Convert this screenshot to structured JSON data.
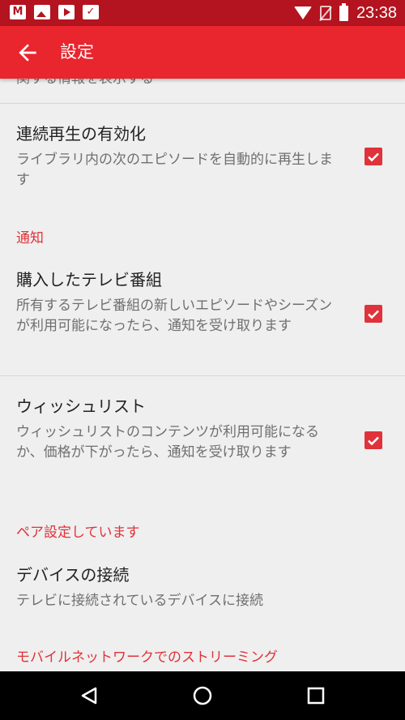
{
  "status_bar": {
    "time": "23:38",
    "left_icons": [
      "mail-icon",
      "photo-icon",
      "play-icon",
      "shopping-icon"
    ],
    "right_icons": [
      "wifi-icon",
      "no-signal-icon",
      "battery-icon"
    ]
  },
  "app_bar": {
    "title": "設定",
    "back_icon": "arrow-back-icon",
    "color": "#e9252d"
  },
  "settings": {
    "clipped_summary": "関する情報を表示する",
    "autoplay": {
      "title": "連続再生の有効化",
      "summary": "ライブラリ内の次のエピソードを自動的に再生します",
      "checked": true
    },
    "notifications_header": "通知",
    "purchased_tv": {
      "title": "購入したテレビ番組",
      "summary": "所有するテレビ番組の新しいエピソードやシーズンが利用可能になったら、通知を受け取ります",
      "checked": true
    },
    "wishlist": {
      "title": "ウィッシュリスト",
      "summary": "ウィッシュリストのコンテンツが利用可能になるか、価格が下がったら、通知を受け取ります",
      "checked": true
    },
    "pairing_header": "ペア設定しています",
    "device_connect": {
      "title": "デバイスの接続",
      "summary": "テレビに接続されているデバイスに接続"
    },
    "mobile_streaming_header": "モバイルネットワークでのストリーミング"
  },
  "nav_bar": {
    "icons": [
      "back-triangle-icon",
      "home-circle-icon",
      "recents-square-icon"
    ]
  },
  "colors": {
    "accent": "#e0323a",
    "status_bar": "#b3141f",
    "background": "#efefef"
  }
}
